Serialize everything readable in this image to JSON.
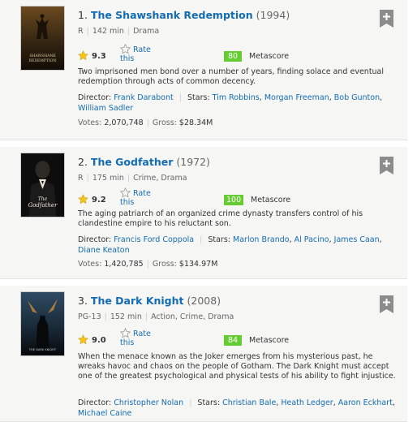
{
  "movies": [
    {
      "rank": "1.",
      "title": "The Shawshank Redemption",
      "year": "(1994)",
      "certificate": "R",
      "runtime": "142 min",
      "genre": "Drama",
      "rating": "9.3",
      "rate_label_1": "Rate",
      "rate_label_2": "this",
      "metascore": "80",
      "metascore_label": "Metascore",
      "description": "Two imprisoned men bond over a number of years, finding solace and eventual redemption through acts of common decency.",
      "director_label": "Director:",
      "director": "Frank Darabont",
      "stars_label": "Stars:",
      "stars": [
        "Tim Robbins",
        "Morgan Freeman",
        "Bob Gunton",
        "William Sadler"
      ],
      "votes_label": "Votes:",
      "votes": "2,070,748",
      "gross_label": "Gross:",
      "gross": "$28.34M",
      "poster_icon": "poster-image"
    },
    {
      "rank": "2.",
      "title": "The Godfather",
      "year": "(1972)",
      "certificate": "R",
      "runtime": "175 min",
      "genre": "Crime, Drama",
      "rating": "9.2",
      "rate_label_1": "Rate",
      "rate_label_2": "this",
      "metascore": "100",
      "metascore_label": "Metascore",
      "description": "The aging patriarch of an organized crime dynasty transfers control of his clandestine empire to his reluctant son.",
      "director_label": "Director:",
      "director": "Francis Ford Coppola",
      "stars_label": "Stars:",
      "stars": [
        "Marlon Brando",
        "Al Pacino",
        "James Caan",
        "Diane Keaton"
      ],
      "votes_label": "Votes:",
      "votes": "1,420,785",
      "gross_label": "Gross:",
      "gross": "$134.97M",
      "poster_icon": "poster-image"
    },
    {
      "rank": "3.",
      "title": "The Dark Knight",
      "year": "(2008)",
      "certificate": "PG-13",
      "runtime": "152 min",
      "genre": "Action, Crime, Drama",
      "rating": "9.0",
      "rate_label_1": "Rate",
      "rate_label_2": "this",
      "metascore": "84",
      "metascore_label": "Metascore",
      "description": "When the menace known as the Joker emerges from his mysterious past, he wreaks havoc and chaos on the people of Gotham. The Dark Knight must accept one of the greatest psychological and physical tests of his ability to fight injustice.",
      "director_label": "Director:",
      "director": "Christopher Nolan",
      "stars_label": "Stars:",
      "stars": [
        "Christian Bale",
        "Heath Ledger",
        "Aaron Eckhart",
        "Michael Caine"
      ],
      "poster_icon": "poster-image"
    }
  ],
  "poster_art": {
    "shawshank_line1": "SHAWSHANK",
    "shawshank_line2": "REDEMPTION",
    "godfather_line1": "The",
    "godfather_line2": "Godfather",
    "darkknight_line1": "THE DARK KNIGHT"
  },
  "colors": {
    "link": "#136cb2",
    "metascore_bg": "#66cc33",
    "card_bg": "#f6f6f5",
    "star_gold": "#f5c518"
  },
  "icons": {
    "rating_star": "gold-star-icon",
    "rate_star": "outline-star-icon",
    "add_button": "bookmark-plus-icon"
  }
}
